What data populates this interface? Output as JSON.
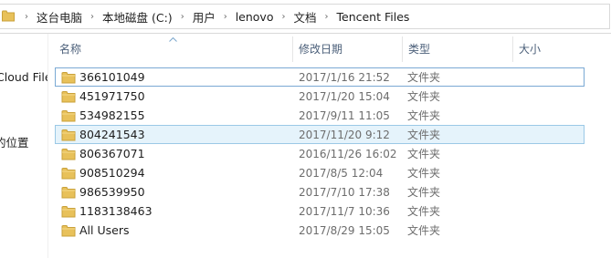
{
  "breadcrumb": {
    "segments": [
      "这台电脑",
      "本地磁盘 (C:)",
      "用户",
      "lenovo",
      "文档",
      "Tencent Files"
    ],
    "separator": "›"
  },
  "nav_pane": {
    "items": [
      "Cloud File",
      "的位置"
    ]
  },
  "columns": {
    "name": "名称",
    "date": "修改日期",
    "type": "类型",
    "size": "大小"
  },
  "files": [
    {
      "name": "366101049",
      "date": "2017/1/16 21:52",
      "type": "文件夹",
      "size": ""
    },
    {
      "name": "451971750",
      "date": "2017/1/20 15:04",
      "type": "文件夹",
      "size": ""
    },
    {
      "name": "534982155",
      "date": "2017/9/11 11:05",
      "type": "文件夹",
      "size": ""
    },
    {
      "name": "804241543",
      "date": "2017/11/20 9:12",
      "type": "文件夹",
      "size": ""
    },
    {
      "name": "806367071",
      "date": "2016/11/26 16:02",
      "type": "文件夹",
      "size": ""
    },
    {
      "name": "908510294",
      "date": "2017/8/5 12:04",
      "type": "文件夹",
      "size": ""
    },
    {
      "name": "986539950",
      "date": "2017/7/10 17:38",
      "type": "文件夹",
      "size": ""
    },
    {
      "name": "1183138463",
      "date": "2017/11/7 10:36",
      "type": "文件夹",
      "size": ""
    },
    {
      "name": "All Users",
      "date": "2017/8/29 15:05",
      "type": "文件夹",
      "size": ""
    }
  ],
  "state": {
    "focused_row": "366101049",
    "selected_row": "804241543"
  },
  "icons": {
    "folder": "folder-icon",
    "sort": "sort-ascending-icon",
    "separator": "chevron-right-icon"
  },
  "colors": {
    "folder": "#e8c15a",
    "selection": "#e5f3fb",
    "selection_border": "#9bc9e6",
    "header_text": "#4c607a"
  }
}
